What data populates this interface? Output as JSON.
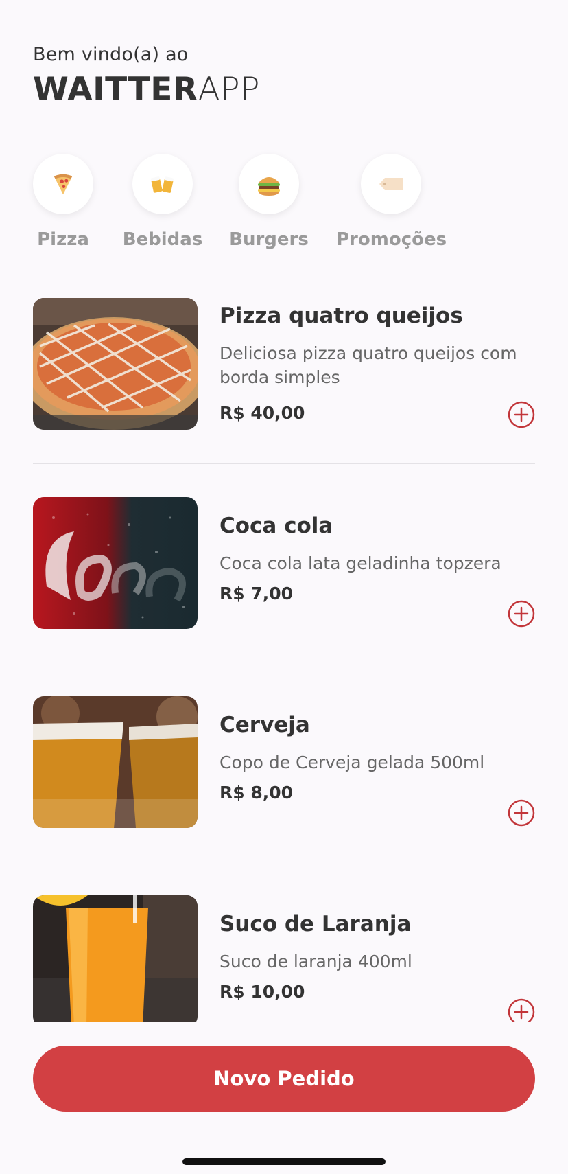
{
  "header": {
    "greeting": "Bem vindo(a) ao",
    "brand_bold": "WAITTER",
    "brand_light": "APP"
  },
  "categories": [
    {
      "label": "Pizza",
      "icon": "pizza-icon"
    },
    {
      "label": "Bebidas",
      "icon": "beer-mugs-icon"
    },
    {
      "label": "Burgers",
      "icon": "burger-icon"
    },
    {
      "label": "Promoções",
      "icon": "price-tag-icon"
    }
  ],
  "products": [
    {
      "name": "Pizza quatro queijos",
      "description": "Deliciosa pizza quatro queijos com borda simples",
      "price": "R$ 40,00",
      "image": "pizza-photo"
    },
    {
      "name": "Coca cola",
      "description": "Coca cola lata geladinha topzera",
      "price": "R$ 7,00",
      "image": "coca-cola-photo"
    },
    {
      "name": "Cerveja",
      "description": "Copo de Cerveja gelada 500ml",
      "price": "R$ 8,00",
      "image": "beer-glasses-photo"
    },
    {
      "name": "Suco de Laranja",
      "description": "Suco de laranja 400ml",
      "price": "R$ 10,00",
      "image": "orange-juice-photo"
    }
  ],
  "actions": {
    "new_order_label": "Novo Pedido"
  },
  "colors": {
    "accent": "#d24043",
    "background": "#fbf9fc",
    "text": "#333333",
    "muted": "#666666",
    "category_label": "#9a9a9a"
  }
}
